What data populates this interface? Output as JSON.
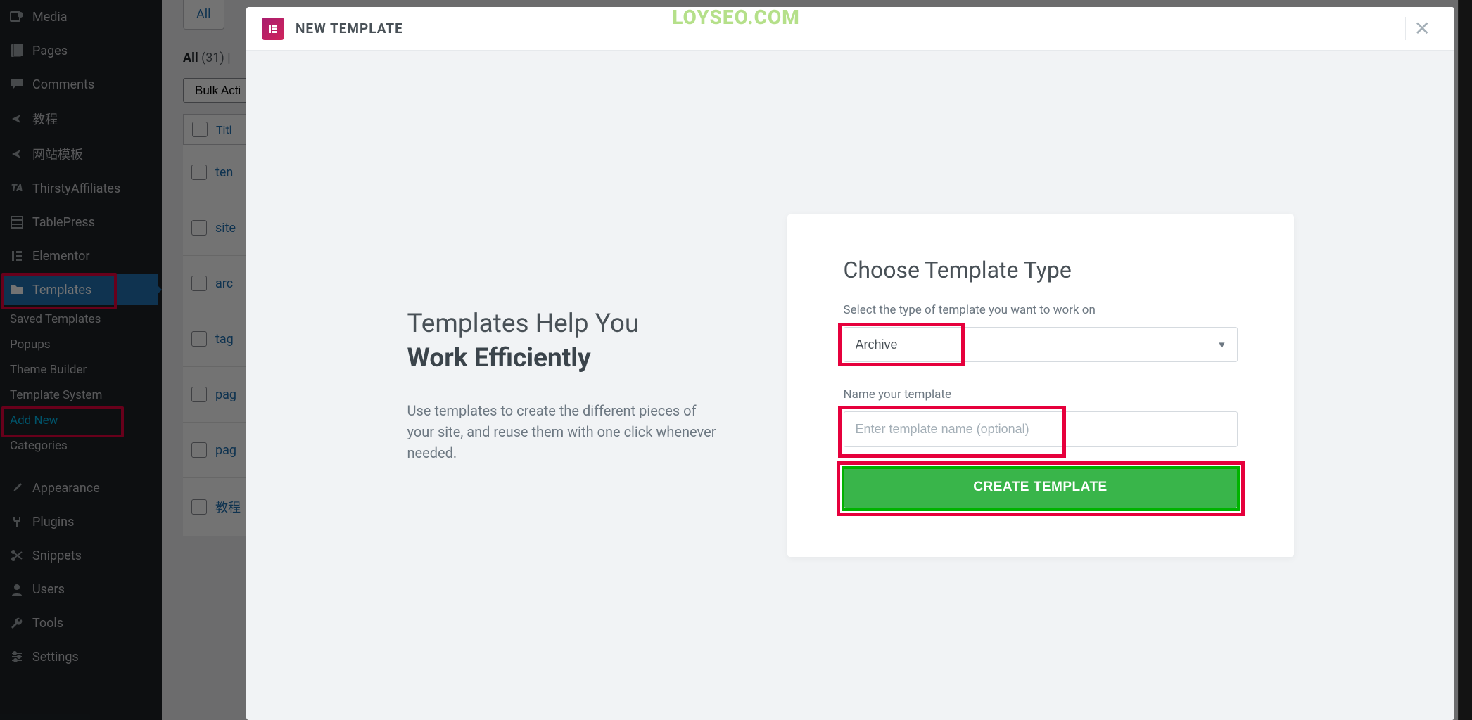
{
  "watermark": "LOYSEO.COM",
  "sidebar": {
    "media": "Media",
    "pages": "Pages",
    "comments": "Comments",
    "tutorial": "教程",
    "site_template": "网站模板",
    "thirsty": "ThirstyAffiliates",
    "tablepress": "TablePress",
    "elementor": "Elementor",
    "templates": "Templates",
    "saved_templates": "Saved Templates",
    "popups": "Popups",
    "theme_builder": "Theme Builder",
    "template_system": "Template System",
    "add_new": "Add New",
    "categories": "Categories",
    "appearance": "Appearance",
    "plugins": "Plugins",
    "snippets": "Snippets",
    "users": "Users",
    "tools": "Tools",
    "settings": "Settings"
  },
  "main": {
    "tab_all": "All",
    "filter_all": "All",
    "filter_count": "(31)",
    "bulk": "Bulk Acti",
    "title_col": "Titl",
    "row_ten": "ten",
    "row_site": "site",
    "row_arc": "arc",
    "row_tag": "tag",
    "row_pag1": "pag",
    "row_pag2": "pag",
    "row_edu": "教程"
  },
  "modal": {
    "title": "NEW TEMPLATE",
    "left_title_1": "Templates Help You",
    "left_title_2": "Work Efficiently",
    "left_desc": "Use templates to create the different pieces of your site, and reuse them with one click whenever needed.",
    "right_title": "Choose Template Type",
    "select_label": "Select the type of template you want to work on",
    "select_value": "Archive",
    "name_label": "Name your template",
    "name_placeholder": "Enter template name (optional)",
    "create_btn": "CREATE TEMPLATE"
  }
}
